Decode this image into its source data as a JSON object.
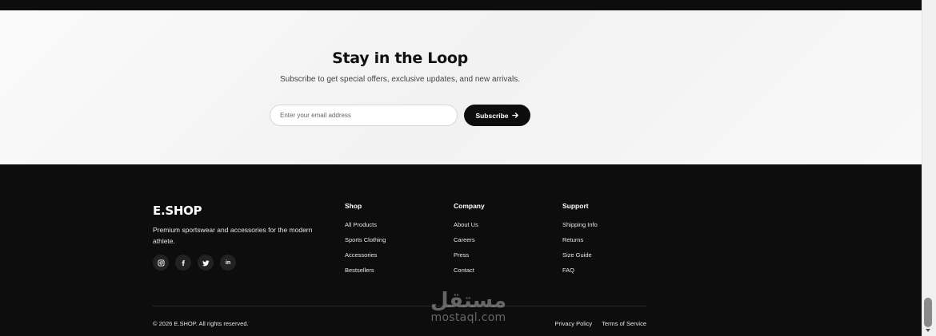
{
  "newsletter": {
    "title": "Stay in the Loop",
    "subtitle": "Subscribe to get special offers, exclusive updates, and new arrivals.",
    "email_placeholder": "Enter your email address",
    "subscribe_label": "Subscribe",
    "subscribe_icon": "arrow-right-icon"
  },
  "footer": {
    "brand": "E.SHOP",
    "tagline": "Premium sportswear and accessories for the modern athlete.",
    "socials": [
      {
        "name": "instagram-icon"
      },
      {
        "name": "facebook-icon"
      },
      {
        "name": "twitter-icon"
      },
      {
        "name": "linkedin-icon",
        "label": "in"
      }
    ],
    "columns": [
      {
        "title": "Shop",
        "links": [
          "All Products",
          "Sports Clothing",
          "Accessories",
          "Bestsellers"
        ]
      },
      {
        "title": "Company",
        "links": [
          "About Us",
          "Careers",
          "Press",
          "Contact"
        ]
      },
      {
        "title": "Support",
        "links": [
          "Shipping Info",
          "Returns",
          "Size Guide",
          "FAQ"
        ]
      }
    ],
    "copyright": "© 2026 E.SHOP. All rights reserved.",
    "legal": [
      "Privacy Policy",
      "Terms of Service"
    ]
  },
  "watermark": {
    "arabic": "مستقل",
    "latin": "mostaql.com"
  },
  "colors": {
    "footer_bg": "#0d0d0d",
    "newsletter_bg": "#f7f7f7",
    "button_bg": "#0d0d0d"
  }
}
